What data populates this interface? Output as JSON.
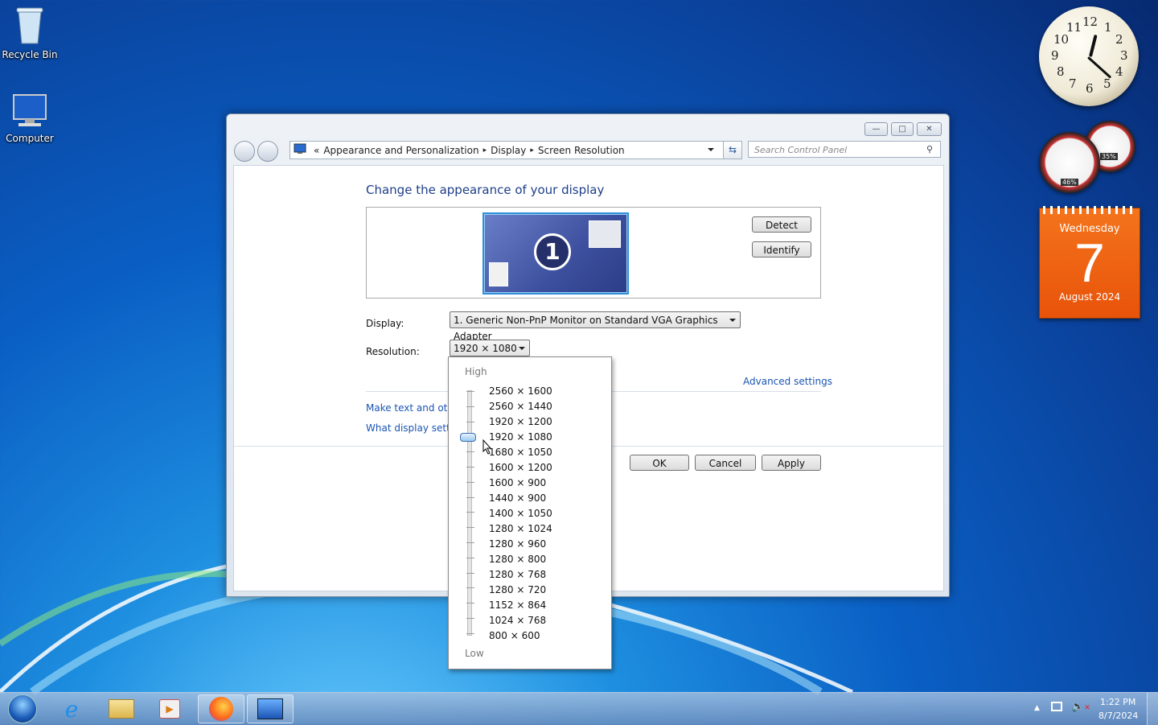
{
  "desktop": {
    "icons": [
      {
        "label": "Recycle Bin",
        "icon": "recycle-bin-icon"
      },
      {
        "label": "Computer",
        "icon": "computer-icon"
      }
    ]
  },
  "gadgets": {
    "clock": {
      "hour_numbers": [
        "12",
        "1",
        "2",
        "3",
        "4",
        "5",
        "6",
        "7",
        "8",
        "9",
        "10",
        "11"
      ],
      "time_shown": "1:22"
    },
    "cpu_meter": {
      "cpu_percent": "46%",
      "memory_percent": "35%"
    },
    "calendar": {
      "weekday": "Wednesday",
      "day": "7",
      "month_year": "August 2024"
    }
  },
  "window": {
    "controls": {
      "minimize": "—",
      "maximize": "□",
      "close": "✕"
    },
    "address": {
      "prefix": "«",
      "crumbs": [
        "Appearance and Personalization",
        "Display",
        "Screen Resolution"
      ],
      "separator": "▸"
    },
    "search_placeholder": "Search Control Panel",
    "heading": "Change the appearance of your display",
    "monitor_number": "1",
    "detect_label": "Detect",
    "identify_label": "Identify",
    "display_label": "Display:",
    "display_value": "1. Generic Non-PnP Monitor on Standard VGA Graphics Adapter",
    "resolution_label": "Resolution:",
    "resolution_value": "1920 × 1080",
    "advanced_link": "Advanced settings",
    "link_text_size": "Make text and other",
    "link_display_settings": "What display setting",
    "ok_label": "OK",
    "cancel_label": "Cancel",
    "apply_label": "Apply"
  },
  "resolution_dropdown": {
    "high_label": "High",
    "low_label": "Low",
    "options": [
      "2560 × 1600",
      "2560 × 1440",
      "1920 × 1200",
      "1920 × 1080",
      "1680 × 1050",
      "1600 × 1200",
      "1600 × 900",
      "1440 × 900",
      "1400 × 1050",
      "1280 × 1024",
      "1280 × 960",
      "1280 × 800",
      "1280 × 768",
      "1280 × 720",
      "1152 × 864",
      "1024 × 768",
      "800 × 600"
    ],
    "selected": "1920 × 1080"
  },
  "taskbar": {
    "items": [
      "start-orb",
      "internet-explorer",
      "windows-explorer",
      "media-player",
      "firefox",
      "control-panel"
    ],
    "time": "1:22 PM",
    "date": "8/7/2024"
  }
}
